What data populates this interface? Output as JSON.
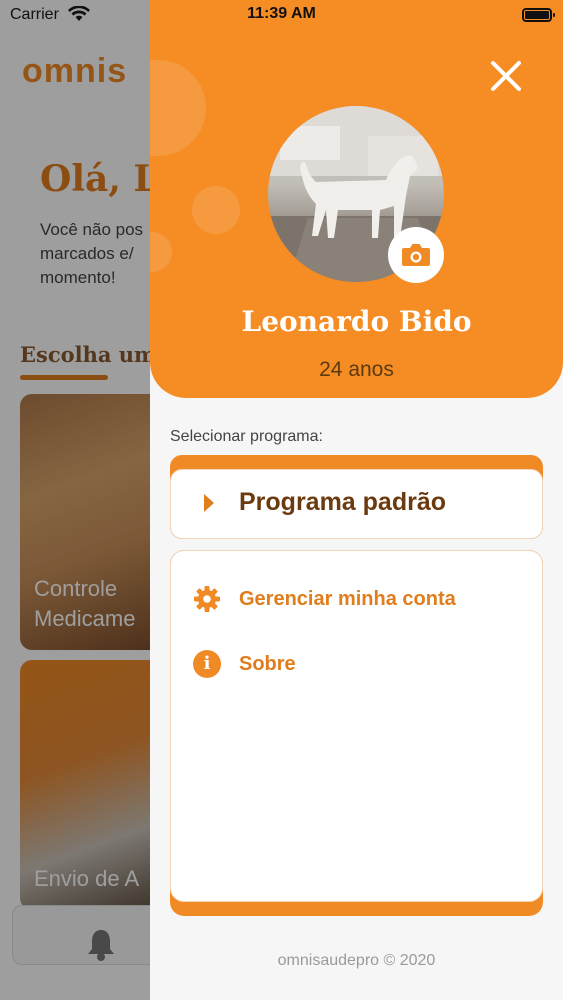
{
  "status_bar": {
    "carrier": "Carrier",
    "time": "11:39 AM"
  },
  "background": {
    "logo": "omnis",
    "greeting": "Olá, Le",
    "message_lines": [
      "Você não pos",
      "marcados e/",
      "momento!"
    ],
    "section_title": "Escolha uma",
    "cards": [
      {
        "line1": "Controle",
        "line2": "Medicame"
      },
      {
        "line1": "Envio de A",
        "line2": ""
      }
    ]
  },
  "drawer": {
    "profile": {
      "name": "Leonardo Bido",
      "age": "24 anos"
    },
    "select_program_label": "Selecionar programa:",
    "selected_program": "Programa padrão",
    "menu": {
      "manage_account": "Gerenciar minha conta",
      "about": "Sobre"
    },
    "footer": "omnisaudepro © 2020"
  },
  "colors": {
    "accent": "#f58c24",
    "accent_dark": "#e07d1d",
    "program_text": "#6b3a0f",
    "age_text": "#5c3a12"
  },
  "icons": [
    "wifi-icon",
    "battery-icon",
    "close-icon",
    "camera-icon",
    "caret-right-icon",
    "gear-icon",
    "info-icon",
    "bell-icon"
  ]
}
